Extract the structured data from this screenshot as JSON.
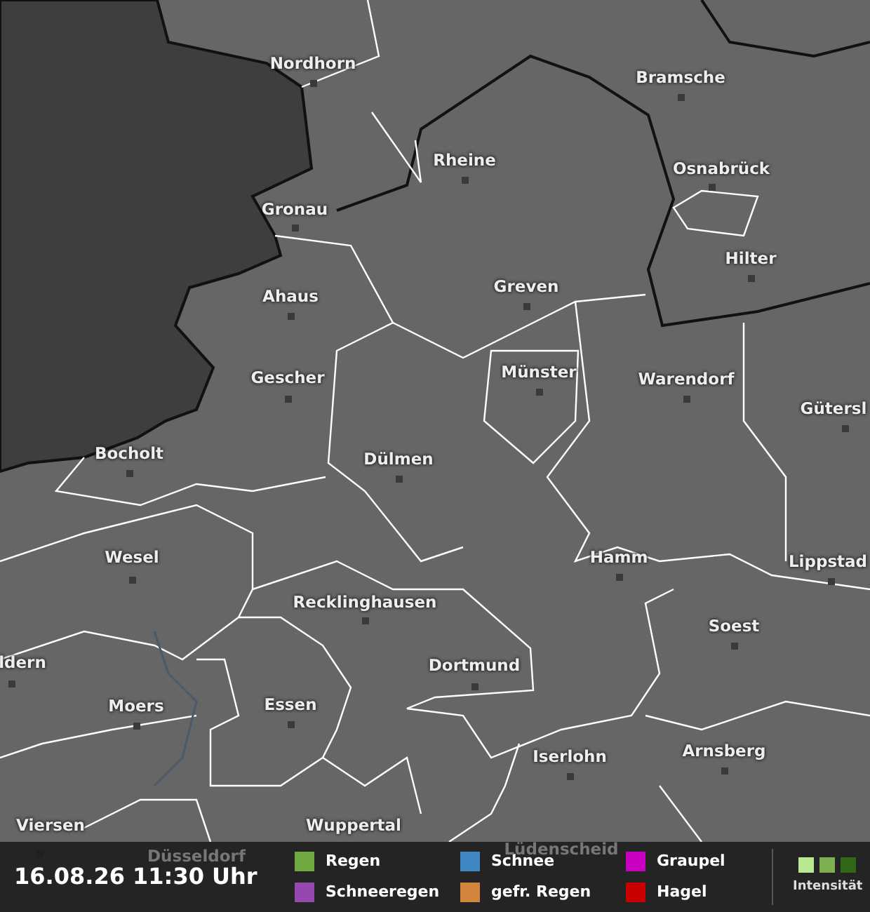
{
  "map": {
    "cities": [
      {
        "name": "Nordhorn"
      },
      {
        "name": "Bramsche"
      },
      {
        "name": "Rheine"
      },
      {
        "name": "Osnabrück"
      },
      {
        "name": "Gronau"
      },
      {
        "name": "Hilter"
      },
      {
        "name": "Ahaus"
      },
      {
        "name": "Greven"
      },
      {
        "name": "Münster"
      },
      {
        "name": "Gescher"
      },
      {
        "name": "Warendorf"
      },
      {
        "name": "Gütersl"
      },
      {
        "name": "Bocholt"
      },
      {
        "name": "Dülmen"
      },
      {
        "name": "Wesel"
      },
      {
        "name": "Hamm"
      },
      {
        "name": "Lippstad"
      },
      {
        "name": "Recklinghausen"
      },
      {
        "name": "Soest"
      },
      {
        "name": "ldern"
      },
      {
        "name": "Dortmund"
      },
      {
        "name": "Moers"
      },
      {
        "name": "Essen"
      },
      {
        "name": "Arnsberg"
      },
      {
        "name": "Iserlohn"
      },
      {
        "name": "Wuppertal"
      },
      {
        "name": "Viersen"
      },
      {
        "name": "Düsseldorf"
      },
      {
        "name": "Lüdenscheid"
      }
    ]
  },
  "legend": {
    "timestamp": "16.08.26 11:30 Uhr",
    "items": [
      {
        "label": "Regen",
        "color": "#70a840"
      },
      {
        "label": "Schneeregen",
        "color": "#9448b0"
      },
      {
        "label": "Schnee",
        "color": "#4088c4"
      },
      {
        "label": "gefr. Regen",
        "color": "#d0843c"
      },
      {
        "label": "Graupel",
        "color": "#c800c0"
      },
      {
        "label": "Hagel",
        "color": "#c80000"
      }
    ],
    "intensity": {
      "label": "Intensität"
    }
  }
}
